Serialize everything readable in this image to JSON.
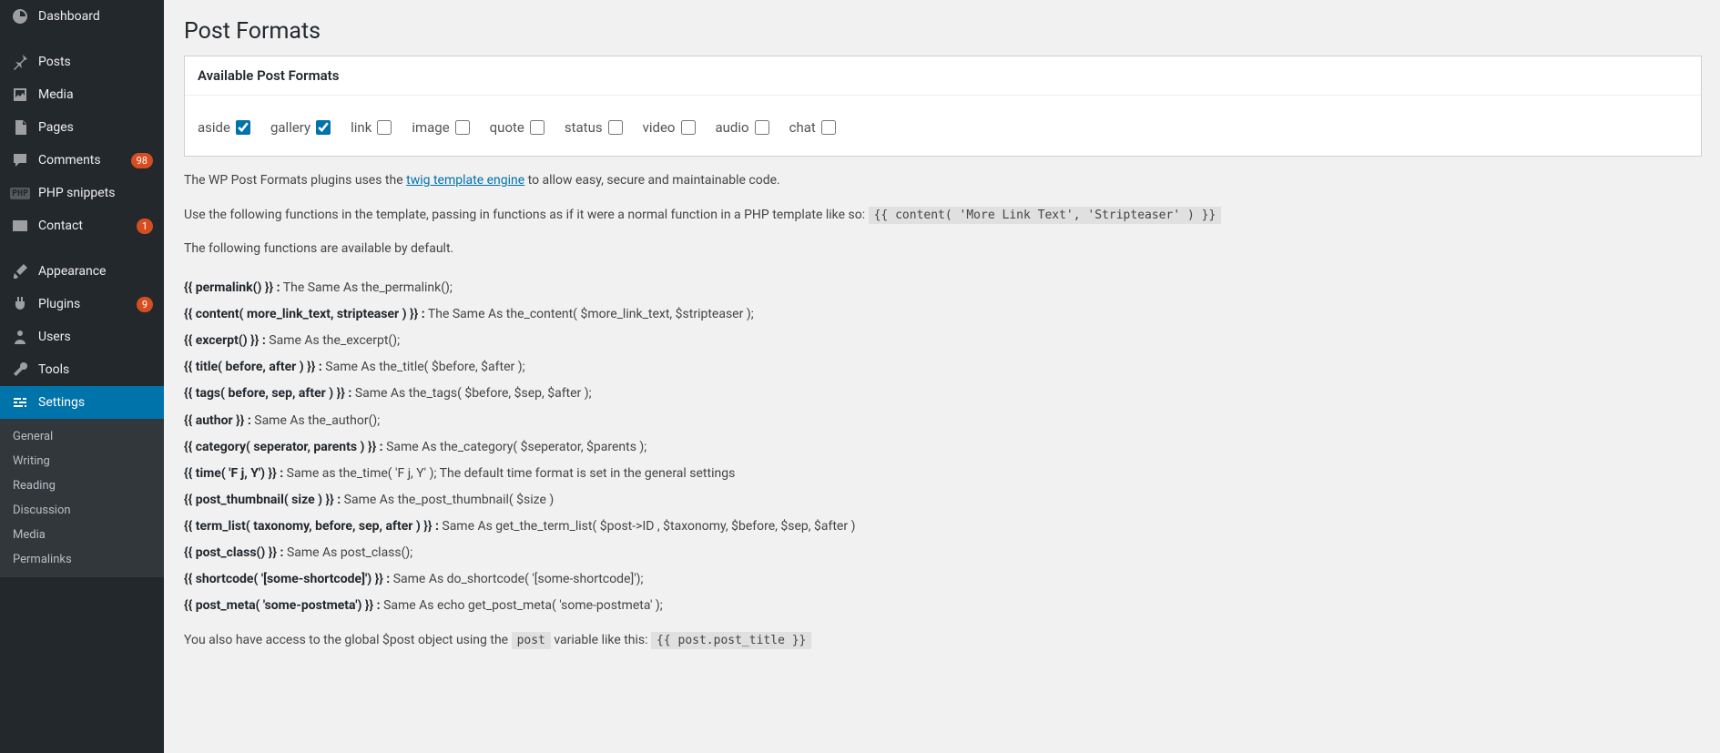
{
  "sidebar": {
    "items": [
      {
        "label": "Dashboard",
        "icon": "dashboard"
      },
      {
        "label": "Posts",
        "icon": "pin"
      },
      {
        "label": "Media",
        "icon": "media"
      },
      {
        "label": "Pages",
        "icon": "pages"
      },
      {
        "label": "Comments",
        "icon": "comment",
        "badge": "98"
      },
      {
        "label": "PHP snippets",
        "icon": "php"
      },
      {
        "label": "Contact",
        "icon": "mail",
        "badge": "1"
      },
      {
        "label": "Appearance",
        "icon": "brush"
      },
      {
        "label": "Plugins",
        "icon": "plug",
        "badge": "9"
      },
      {
        "label": "Users",
        "icon": "user"
      },
      {
        "label": "Tools",
        "icon": "wrench"
      },
      {
        "label": "Settings",
        "icon": "sliders",
        "active": true
      }
    ],
    "submenu": [
      "General",
      "Writing",
      "Reading",
      "Discussion",
      "Media",
      "Permalinks"
    ]
  },
  "page": {
    "title": "Post Formats",
    "panel_title": "Available Post Formats"
  },
  "formats": [
    {
      "name": "aside",
      "checked": true
    },
    {
      "name": "gallery",
      "checked": true
    },
    {
      "name": "link",
      "checked": false
    },
    {
      "name": "image",
      "checked": false
    },
    {
      "name": "quote",
      "checked": false
    },
    {
      "name": "status",
      "checked": false
    },
    {
      "name": "video",
      "checked": false
    },
    {
      "name": "audio",
      "checked": false
    },
    {
      "name": "chat",
      "checked": false
    }
  ],
  "intro": {
    "p1a": "The WP Post Formats plugins uses the ",
    "link_text": "twig template engine",
    "p1b": " to allow easy, secure and maintainable code.",
    "p2a": "Use the following functions in the template, passing in functions as if it were a normal function in a PHP template like so: ",
    "code1": "{{ content( 'More Link Text', 'Stripteaser' ) }}",
    "p3": "The following functions are available by default."
  },
  "functions": [
    {
      "sig": "{{ permalink() }} :",
      "desc": " The Same As the_permalink();"
    },
    {
      "sig": "{{ content( more_link_text, stripteaser ) }} :",
      "desc": " The Same As the_content( $more_link_text, $stripteaser );"
    },
    {
      "sig": "{{ excerpt() }} :",
      "desc": " Same As the_excerpt();"
    },
    {
      "sig": "{{ title( before, after ) }} :",
      "desc": " Same As the_title( $before, $after );"
    },
    {
      "sig": "{{ tags( before, sep, after ) }} :",
      "desc": " Same As the_tags( $before, $sep, $after );"
    },
    {
      "sig": "{{ author }} :",
      "desc": " Same As the_author();"
    },
    {
      "sig": "{{ category( seperator, parents ) }} :",
      "desc": " Same As the_category( $seperator, $parents );"
    },
    {
      "sig": "{{ time( 'F j, Y') }} :",
      "desc": " Same as the_time( 'F j, Y' ); The default time format is set in the general settings"
    },
    {
      "sig": "{{ post_thumbnail( size ) }} :",
      "desc": " Same As the_post_thumbnail( $size )"
    },
    {
      "sig": "{{ term_list( taxonomy, before, sep, after ) }} :",
      "desc": " Same As get_the_term_list( $post->ID , $taxonomy, $before, $sep, $after )"
    },
    {
      "sig": "{{ post_class() }} :",
      "desc": " Same As post_class();"
    },
    {
      "sig": "{{ shortcode( '[some-shortcode]') }} :",
      "desc": " Same As do_shortcode( '[some-shortcode]');"
    },
    {
      "sig": "{{ post_meta( 'some-postmeta') }} :",
      "desc": " Same As echo get_post_meta( 'some-postmeta' );"
    }
  ],
  "outro": {
    "a": "You also have access to the global $post object using the ",
    "code1": "post",
    "b": " variable like this: ",
    "code2": "{{ post.post_title }}"
  }
}
